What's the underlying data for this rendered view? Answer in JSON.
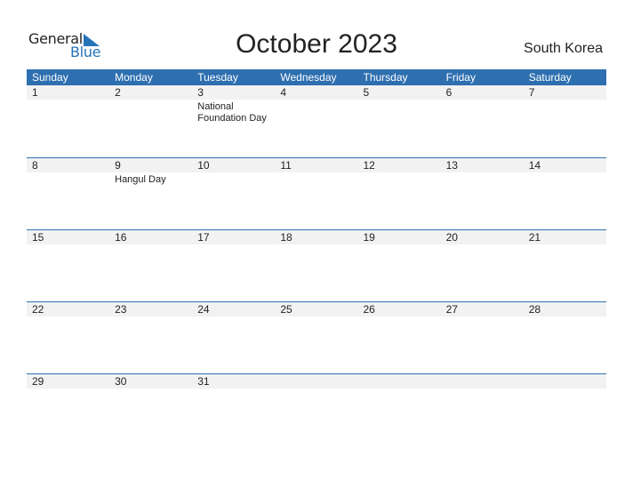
{
  "logo": {
    "word1": "General",
    "word2": "Blue"
  },
  "title": "October 2023",
  "country": "South Korea",
  "colors": {
    "accent": "#2e6fb0",
    "date_strip": "#f2f2f2"
  },
  "weekdays": [
    "Sunday",
    "Monday",
    "Tuesday",
    "Wednesday",
    "Thursday",
    "Friday",
    "Saturday"
  ],
  "weeks": [
    {
      "days": [
        "1",
        "2",
        "3",
        "4",
        "5",
        "6",
        "7"
      ],
      "events": [
        "",
        "",
        "National Foundation Day",
        "",
        "",
        "",
        ""
      ]
    },
    {
      "days": [
        "8",
        "9",
        "10",
        "11",
        "12",
        "13",
        "14"
      ],
      "events": [
        "",
        "Hangul Day",
        "",
        "",
        "",
        "",
        ""
      ]
    },
    {
      "days": [
        "15",
        "16",
        "17",
        "18",
        "19",
        "20",
        "21"
      ],
      "events": [
        "",
        "",
        "",
        "",
        "",
        "",
        ""
      ]
    },
    {
      "days": [
        "22",
        "23",
        "24",
        "25",
        "26",
        "27",
        "28"
      ],
      "events": [
        "",
        "",
        "",
        "",
        "",
        "",
        ""
      ]
    },
    {
      "days": [
        "29",
        "30",
        "31",
        "",
        "",
        "",
        ""
      ],
      "events": [
        "",
        "",
        "",
        "",
        "",
        "",
        ""
      ]
    }
  ]
}
